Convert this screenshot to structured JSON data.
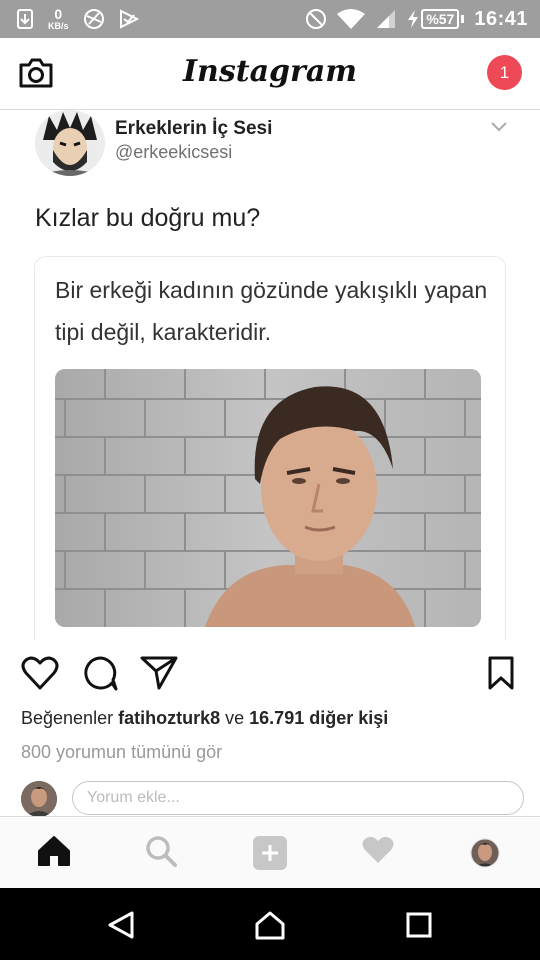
{
  "status_bar": {
    "speed_value": "0",
    "speed_unit": "KB/s",
    "battery": "%57",
    "time": "16:41"
  },
  "header": {
    "brand": "Instagram",
    "notification_count": "1"
  },
  "post_image": {
    "author_name": "Erkeklerin İç Sesi",
    "author_handle": "@erkeekicsesi",
    "tweet_text": "Kızlar bu doğru mu?",
    "card_text": "Bir erkeği kadının gözünde yakışıklı yapan tipi değil, karakteridir."
  },
  "post": {
    "likes_label": "Beğenenler",
    "likes_user": "fatihozturk8",
    "likes_joiner": "ve",
    "likes_others": "16.791 diğer kişi",
    "view_comments": "800 yorumun tümünü gör",
    "comment_placeholder": "Yorum ekle..."
  },
  "colors": {
    "status_bar": "#9e9e9e",
    "notification": "#ed4956",
    "text_primary": "#262626",
    "text_muted": "#999999",
    "divider": "#dbdbdb"
  },
  "icons": {
    "header": [
      "camera-icon"
    ],
    "actions": [
      "heart-icon",
      "comment-icon",
      "share-icon",
      "bookmark-icon"
    ],
    "tabs": [
      "home-icon",
      "search-icon",
      "add-icon",
      "activity-heart-icon",
      "profile-avatar"
    ],
    "nav": [
      "back-icon",
      "home-nav-icon",
      "recents-icon"
    ]
  }
}
